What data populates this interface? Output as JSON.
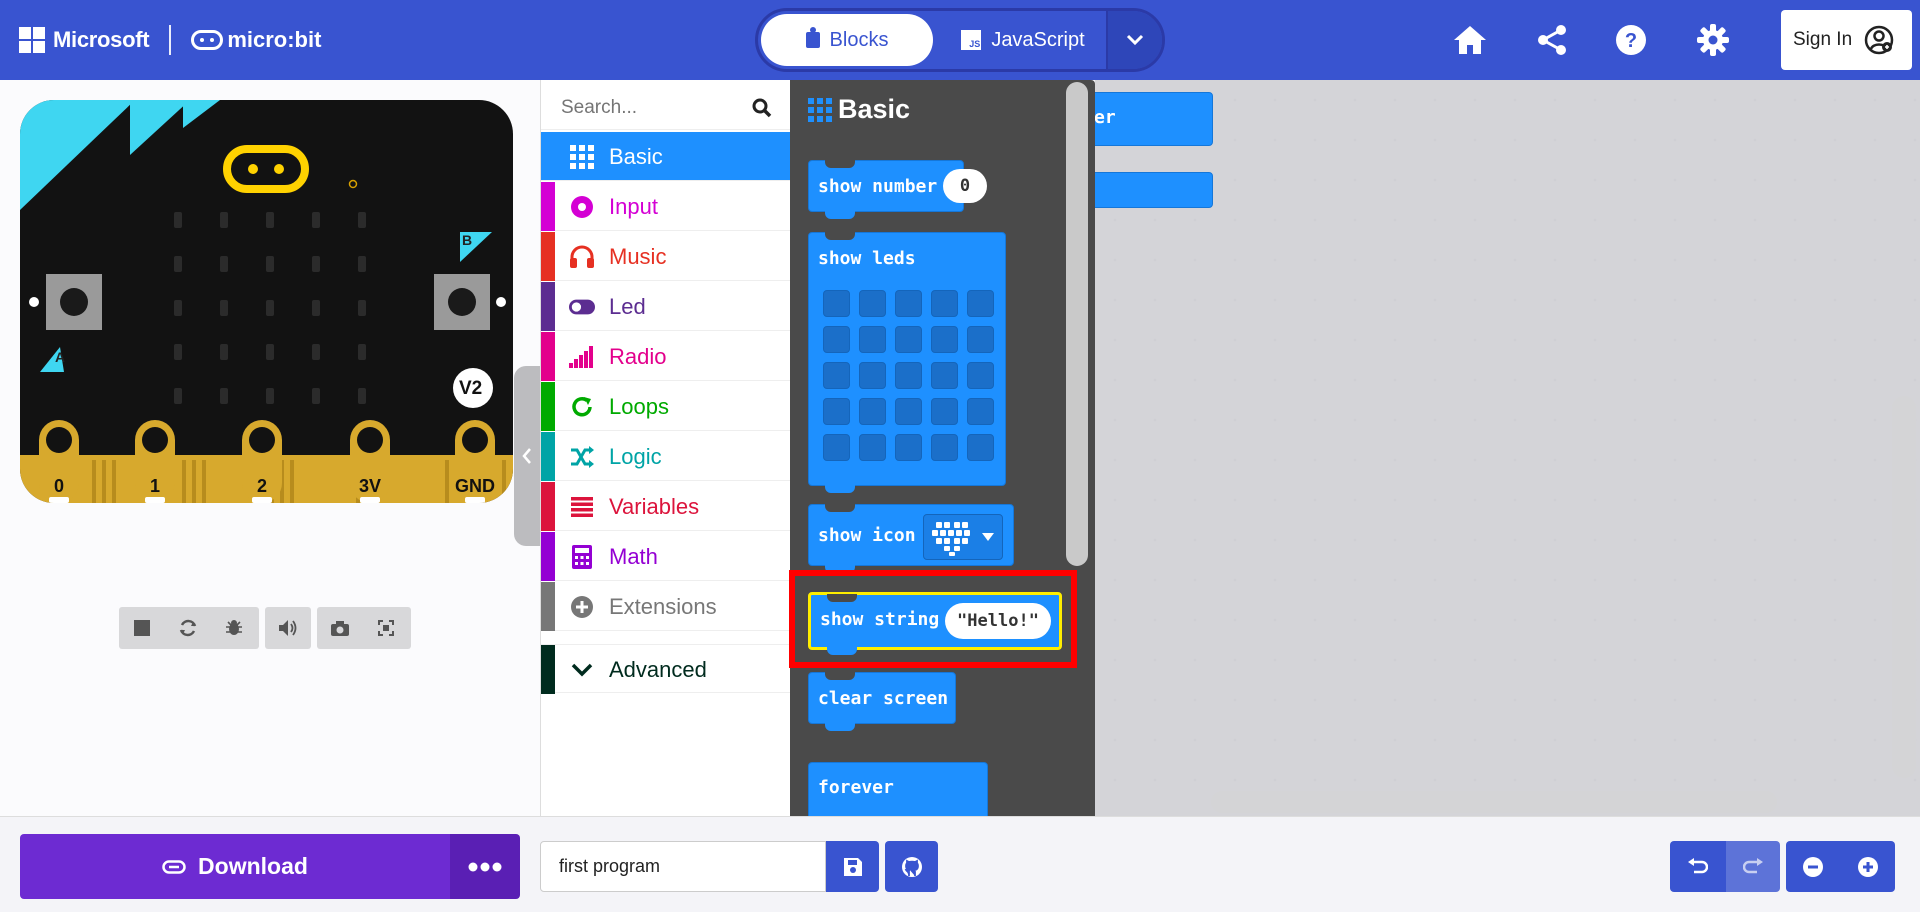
{
  "header": {
    "brand_ms": "Microsoft",
    "brand_mb": "micro:bit",
    "tab_blocks": "Blocks",
    "tab_js": "JavaScript",
    "js_badge": "JS",
    "sign_in": "Sign In",
    "icons": [
      "home-icon",
      "share-icon",
      "help-icon",
      "gear-icon",
      "user-icon"
    ]
  },
  "simulator": {
    "pins": [
      "0",
      "1",
      "2",
      "3V",
      "GND"
    ],
    "button_a": "A",
    "button_b": "B",
    "version": "V2",
    "controls": [
      "stop-icon",
      "restart-icon",
      "debug-icon",
      "sound-icon",
      "screenshot-icon",
      "fullscreen-icon"
    ]
  },
  "toolbox": {
    "search_placeholder": "Search...",
    "categories": [
      {
        "label": "Basic",
        "color": "#1e90ff"
      },
      {
        "label": "Input",
        "color": "#d400d4"
      },
      {
        "label": "Music",
        "color": "#e63022"
      },
      {
        "label": "Led",
        "color": "#5c2d91"
      },
      {
        "label": "Radio",
        "color": "#e3008c"
      },
      {
        "label": "Loops",
        "color": "#00aa00"
      },
      {
        "label": "Logic",
        "color": "#00a4a6"
      },
      {
        "label": "Variables",
        "color": "#dc143c"
      },
      {
        "label": "Math",
        "color": "#9400d3"
      },
      {
        "label": "Extensions",
        "color": "#777777"
      },
      {
        "label": "Advanced",
        "color": "#002b1e"
      }
    ]
  },
  "flyout": {
    "title": "Basic",
    "blocks": {
      "show_number": "show number",
      "show_number_value": "0",
      "show_leds": "show leds",
      "show_icon": "show icon",
      "show_string": "show string",
      "show_string_value": "\"Hello!\"",
      "clear_screen": "clear screen",
      "forever": "forever"
    }
  },
  "workspace": {
    "block1_fragment": "er"
  },
  "footer": {
    "download": "Download",
    "project_name": "first program"
  }
}
